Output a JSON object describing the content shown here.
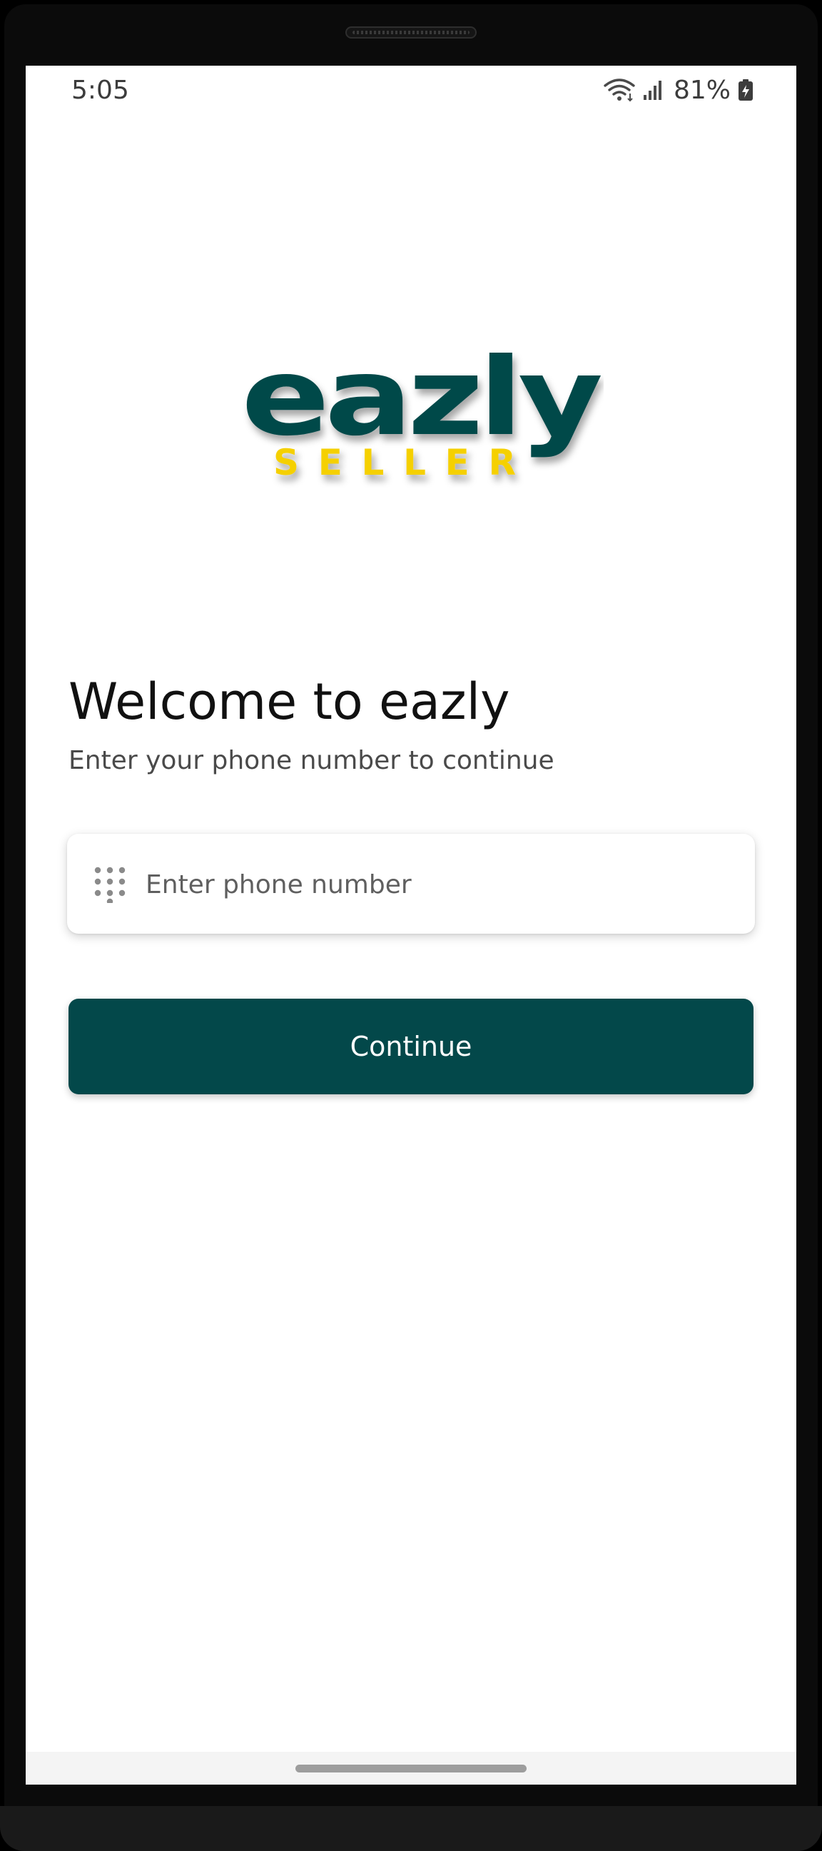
{
  "status_bar": {
    "time": "5:05",
    "battery_percent": "81%",
    "icons": [
      "wifi-icon",
      "signal-icon",
      "battery-charging-icon"
    ]
  },
  "logo": {
    "brand_text": "eazly",
    "sub_text": "SELLER",
    "brand_color": "#03484a",
    "sub_color": "#f5d000"
  },
  "welcome": {
    "title": "Welcome to eazly",
    "subtitle": "Enter your phone number to continue"
  },
  "phone_field": {
    "placeholder": "Enter phone number",
    "value": "",
    "icon": "dialpad-icon"
  },
  "continue_button": {
    "label": "Continue",
    "color": "#03484a"
  },
  "theme": {
    "accent": "#03484a",
    "logo_yellow": "#f5d000"
  }
}
